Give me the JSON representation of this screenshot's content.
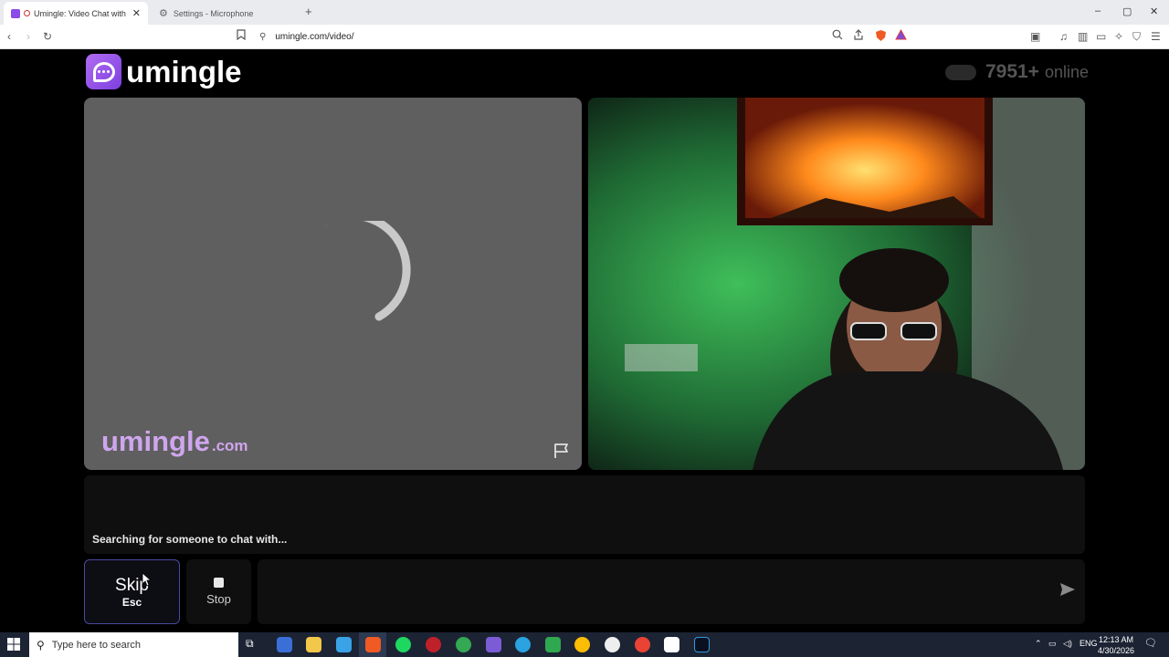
{
  "browser": {
    "tabs": [
      {
        "title": "Umingle: Video Chat with Str",
        "active": true
      },
      {
        "title": "Settings - Microphone",
        "active": false
      }
    ],
    "new_tab": "+",
    "window_controls": {
      "minimize": "–",
      "maximize": "▢",
      "close": "✕"
    },
    "url": "umingle.com/video/"
  },
  "header": {
    "logo_text": "umingle",
    "online_count": "7951+",
    "online_label": "online"
  },
  "video_left": {
    "watermark_main": "umingle",
    "watermark_suffix": ".com"
  },
  "chat": {
    "status": "Searching for someone to chat with..."
  },
  "controls": {
    "skip_label": "Skip",
    "skip_key": "Esc",
    "stop_label": "Stop"
  },
  "taskbar": {
    "search_placeholder": "Type here to search",
    "language": "ENG",
    "time": "12:13 AM",
    "date": "4/30/2026"
  },
  "colors": {
    "brand_purple": "#9b55ec",
    "watermark": "#cfa6ee",
    "skip_border": "#4a4aa0"
  }
}
